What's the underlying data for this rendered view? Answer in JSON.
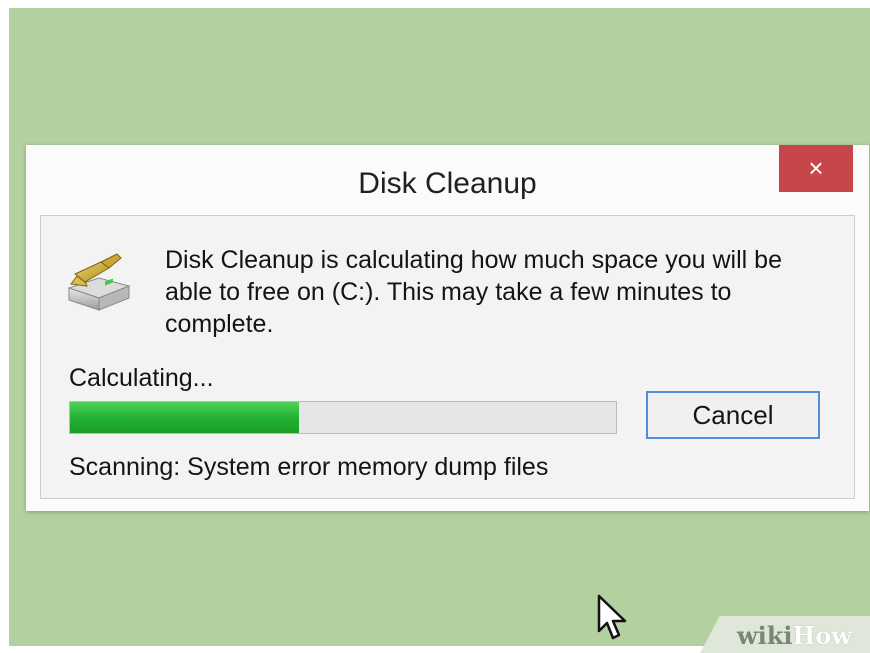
{
  "dialog": {
    "title": "Disk Cleanup",
    "close_label": "×",
    "message": "Disk Cleanup is calculating how much space you will be able to free on  (C:). This may take a few minutes to complete.",
    "status_text": "Calculating...",
    "progress_fraction": 0.42,
    "cancel_label": "Cancel",
    "scanning_text": "Scanning:  System error memory dump files",
    "icon": "disk-cleanup-icon"
  },
  "watermark": {
    "part1": "wiki",
    "part2": "How"
  },
  "colors": {
    "desktop": "#b3d0a0",
    "close_button": "#c74649",
    "progress_fill": "#24b232",
    "focus_border": "#4f8fd9"
  }
}
